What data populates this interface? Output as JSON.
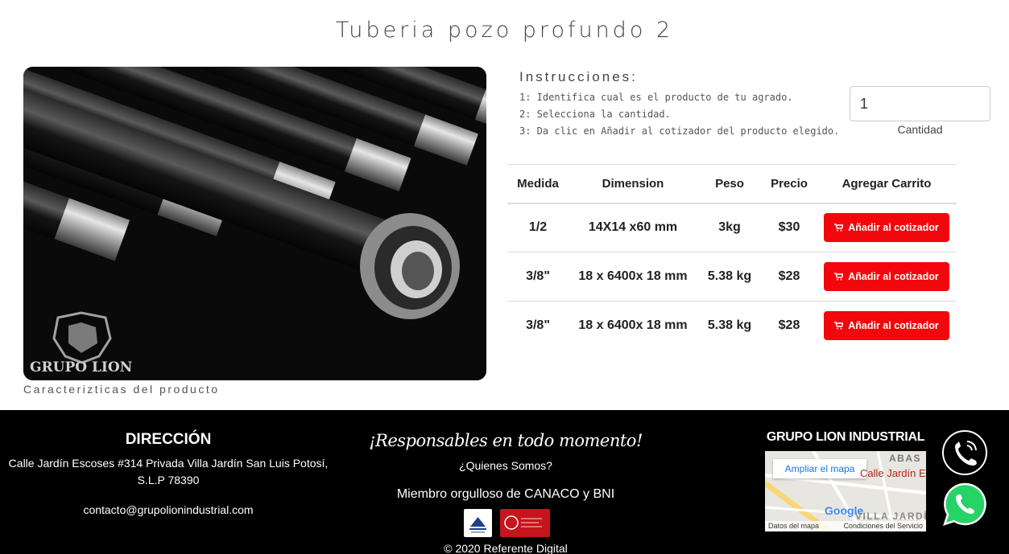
{
  "page": {
    "title": "Tuberia pozo profundo 2",
    "image_caption": "Caracterizticas del producto",
    "image_brand": "GRUPO LION"
  },
  "instructions": {
    "title": "Instrucciones:",
    "steps": [
      "1: Identifica cual es el producto de tu agrado.",
      "2: Selecciona la cantidad.",
      "3: Da clic en Añadir al cotizador del producto elegido."
    ]
  },
  "quantity": {
    "value": "1",
    "label": "Cantidad"
  },
  "table": {
    "headers": [
      "Medida",
      "Dimension",
      "Peso",
      "Precio",
      "Agregar Carrito"
    ],
    "rows": [
      {
        "medida": "1/2",
        "dimension": "14X14 x60 mm",
        "peso": "3kg",
        "precio": "$30",
        "button": "Añadir al cotizador"
      },
      {
        "medida": "3/8\"",
        "dimension": "18 x 6400x 18 mm",
        "peso": "5.38 kg",
        "precio": "$28",
        "button": "Añadir al cotizador"
      },
      {
        "medida": "3/8\"",
        "dimension": "18 x 6400x 18 mm",
        "peso": "5.38 kg",
        "precio": "$28",
        "button": "Añadir al cotizador"
      }
    ]
  },
  "footer": {
    "address_heading": "DIRECCIÓN",
    "address": "Calle Jardín Escoses #314 Privada Villa Jardín San Luis Potosí, S.L.P 78390",
    "email": "contacto@grupolionindustrial.com",
    "slogan": "¡Responsables en todo momento!",
    "about_link": "¿Quienes Somos?",
    "member_text": "Miembro orgulloso de CANACO y BNI",
    "copyright": "© 2020 Referente Digital",
    "company_heading": "GRUPO LION INDUSTRIAL",
    "map": {
      "link": "Ampliar el mapa",
      "street": "Calle Jardín E",
      "area_top": "ABAS",
      "area_bottom": "VILLA JARDÍN",
      "logo": "Google",
      "data_label": "Datos del mapa",
      "terms": "Condiciones del Servicio"
    }
  },
  "colors": {
    "accent": "#f4070c",
    "footer_bg": "#000000",
    "whatsapp": "#25d366"
  },
  "icons": [
    "cart-icon",
    "phone-icon",
    "whatsapp-icon",
    "map-pin-icon"
  ]
}
